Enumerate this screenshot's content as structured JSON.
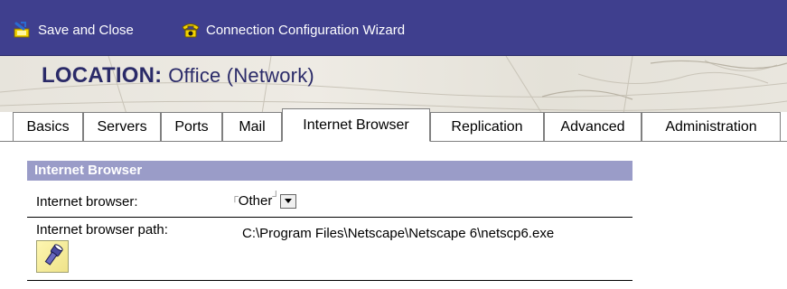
{
  "toolbar": {
    "save_close_label": "Save and Close",
    "wizard_label": "Connection Configuration Wizard",
    "background": "#3f3f8e"
  },
  "banner": {
    "location_label": "LOCATION",
    "separator": ":",
    "location_value": "Office (Network)"
  },
  "tabs": [
    {
      "label": "Basics",
      "active": false
    },
    {
      "label": "Servers",
      "active": false
    },
    {
      "label": "Ports",
      "active": false
    },
    {
      "label": "Mail",
      "active": false
    },
    {
      "label": "Internet Browser",
      "active": true
    },
    {
      "label": "Replication",
      "active": false
    },
    {
      "label": "Advanced",
      "active": false
    },
    {
      "label": "Administration",
      "active": false
    }
  ],
  "section": {
    "title": "Internet Browser",
    "header_color": "#9a9cc8"
  },
  "fields": {
    "browser": {
      "label": "Internet browser:",
      "value": "Other",
      "icon": "chevron-down-icon"
    },
    "path": {
      "label": "Internet browser path:",
      "value": "C:\\Program Files\\Netscape\\Netscape 6\\netscp6.exe",
      "browse_icon": "flashlight-icon"
    }
  }
}
